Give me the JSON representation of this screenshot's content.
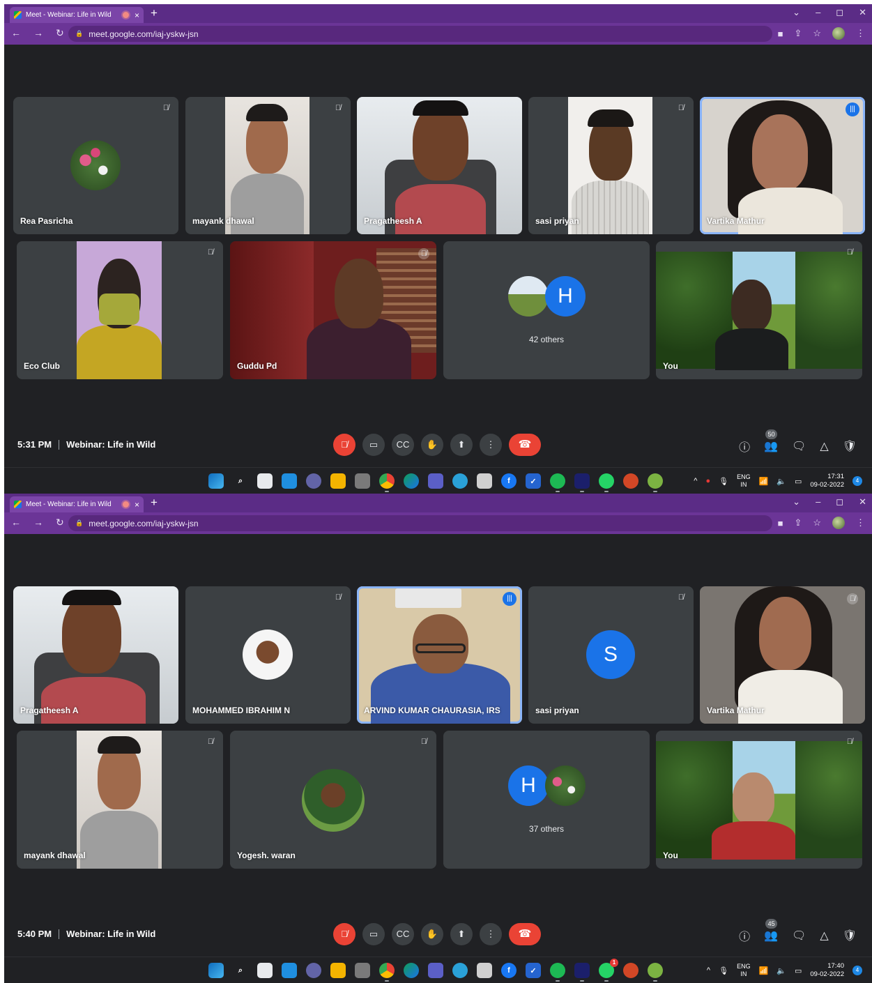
{
  "browser": {
    "tab_title": "Meet - Webinar: Life in Wild",
    "tab_close": "×",
    "new_tab": "+",
    "url": "meet.google.com/iaj-yskw-jsn",
    "window_controls": [
      "⌄",
      "–",
      "◻",
      "✕"
    ]
  },
  "screenshots": [
    {
      "time": "5:31 PM",
      "meeting_title": "Webinar: Life in Wild",
      "participants_count": "50",
      "tiles": [
        {
          "name": "Rea Pasricha",
          "muted": true
        },
        {
          "name": "mayank dhawal",
          "muted": true
        },
        {
          "name": "Pragatheesh A",
          "muted": false
        },
        {
          "name": "sasi priyan",
          "muted": true
        },
        {
          "name": "Vartika Mathur",
          "muted": false,
          "speaking": true
        },
        {
          "name": "Eco Club",
          "muted": true
        },
        {
          "name": "Guddu Pd",
          "muted": true
        },
        {
          "name": "",
          "others": "42 others",
          "letter": "H"
        },
        {
          "name": "You",
          "muted": true
        }
      ],
      "clock_time": "17:31",
      "clock_date": "09-02-2022",
      "notif_count": "4"
    },
    {
      "time": "5:40 PM",
      "meeting_title": "Webinar: Life in Wild",
      "participants_count": "45",
      "tiles": [
        {
          "name": "Pragatheesh A",
          "muted": false
        },
        {
          "name": "MOHAMMED IBRAHIM N",
          "muted": true
        },
        {
          "name": "ARVIND KUMAR CHAURASIA, IRS",
          "muted": false,
          "speaking": true
        },
        {
          "name": "sasi priyan",
          "muted": true,
          "letter": "S"
        },
        {
          "name": "Vartika Mathur",
          "muted": true
        },
        {
          "name": "mayank dhawal",
          "muted": true
        },
        {
          "name": "Yogesh. waran",
          "muted": true
        },
        {
          "name": "",
          "others": "37 others",
          "letter": "H"
        },
        {
          "name": "You",
          "muted": true
        }
      ],
      "clock_time": "17:40",
      "clock_date": "09-02-2022",
      "notif_count": "4",
      "whatsapp_badge": "1"
    }
  ],
  "tray": {
    "lang_line1": "ENG",
    "lang_line2": "IN"
  },
  "colors": {
    "meet_bg": "#202124",
    "tile_bg": "#3c4043",
    "chrome": "#6b3597",
    "end_call": "#ea4335",
    "accent": "#1a73e8"
  }
}
